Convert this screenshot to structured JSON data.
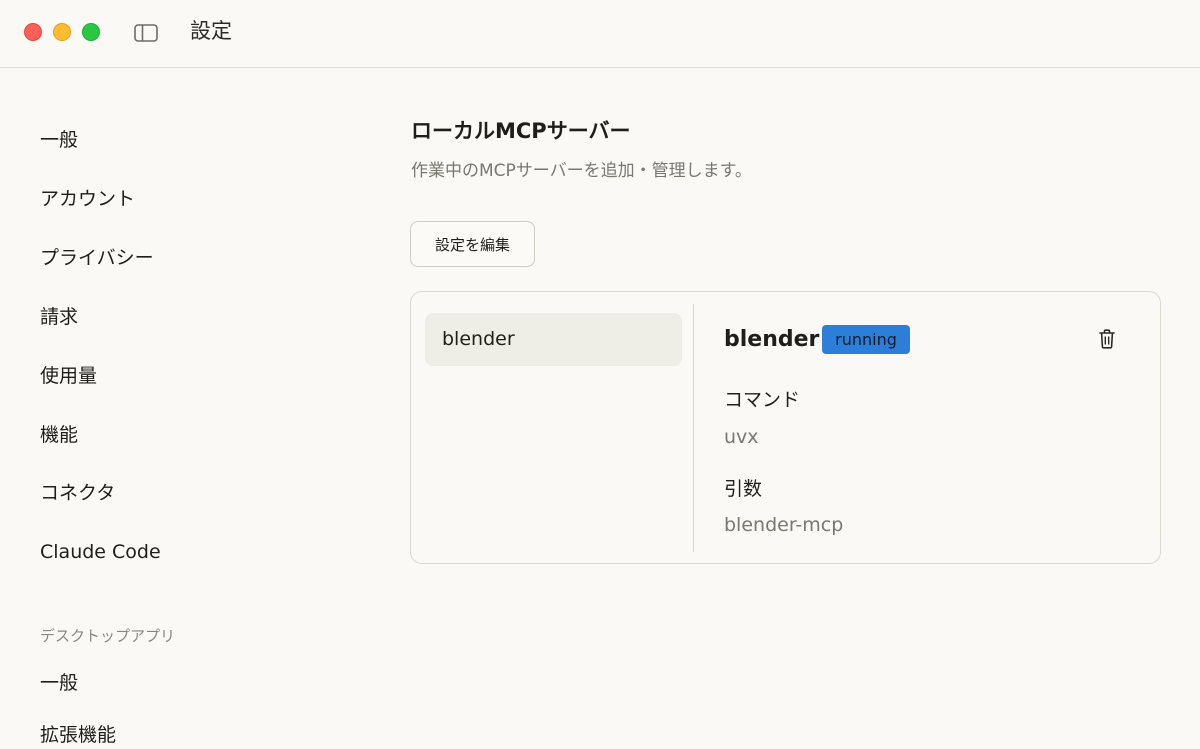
{
  "window": {
    "title": "設定"
  },
  "nav": {
    "items": [
      "一般",
      "アカウント",
      "プライバシー",
      "請求",
      "使用量",
      "機能",
      "コネクタ",
      "Claude Code"
    ],
    "desktop_section_label": "デスクトップアプリ",
    "desktop_items": [
      "一般",
      "拡張機能"
    ]
  },
  "main": {
    "title": "ローカルMCPサーバー",
    "description": "作業中のMCPサーバーを追加・管理します。",
    "edit_button": "設定を編集"
  },
  "servers": {
    "list": [
      "blender"
    ],
    "selected": {
      "name": "blender",
      "status": "running",
      "status_color": "#2c7fd8",
      "command_label": "コマンド",
      "command_value": "uvx",
      "args_label": "引数",
      "args_value": "blender-mcp"
    }
  },
  "icons": {
    "sidebar_toggle": "sidebar-icon",
    "delete": "trash-icon"
  }
}
